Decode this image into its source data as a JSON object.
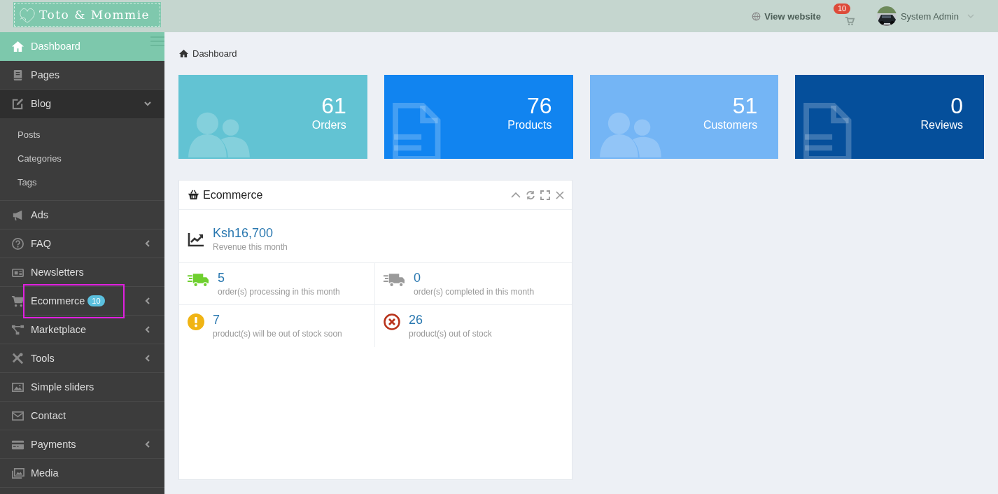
{
  "header": {
    "logo": "Toto & Mommie",
    "view_website": "View website",
    "cart_badge": "10",
    "user_name": "System Admin"
  },
  "sidebar": {
    "items": [
      {
        "label": "Dashboard",
        "kind": "link",
        "selected": true
      },
      {
        "label": "Pages",
        "kind": "link",
        "selected": false
      },
      {
        "label": "Blog",
        "kind": "group",
        "selected": false,
        "expanded": true,
        "children": [
          {
            "label": "Posts"
          },
          {
            "label": "Categories"
          },
          {
            "label": "Tags"
          }
        ]
      },
      {
        "label": "Ads",
        "kind": "link",
        "selected": false
      },
      {
        "label": "FAQ",
        "kind": "group",
        "selected": false,
        "expanded": false
      },
      {
        "label": "Newsletters",
        "kind": "link",
        "selected": false
      },
      {
        "label": "Ecommerce",
        "kind": "group",
        "selected": false,
        "expanded": false,
        "badge": "10",
        "highlighted": true
      },
      {
        "label": "Marketplace",
        "kind": "group",
        "selected": false,
        "expanded": false
      },
      {
        "label": "Tools",
        "kind": "group",
        "selected": false,
        "expanded": false
      },
      {
        "label": "Simple sliders",
        "kind": "link",
        "selected": false
      },
      {
        "label": "Contact",
        "kind": "link",
        "selected": false
      },
      {
        "label": "Payments",
        "kind": "group",
        "selected": false,
        "expanded": false
      },
      {
        "label": "Media",
        "kind": "link",
        "selected": false
      }
    ]
  },
  "breadcrumb": "Dashboard",
  "stat_cards": [
    {
      "value": "61",
      "label": "Orders",
      "color": "#62c3d3",
      "kind": "users"
    },
    {
      "value": "76",
      "label": "Products",
      "color": "#1184f0",
      "kind": "document"
    },
    {
      "value": "51",
      "label": "Customers",
      "color": "#74b5f5",
      "kind": "users"
    },
    {
      "value": "0",
      "label": "Reviews",
      "color": "#054f9b",
      "kind": "document"
    }
  ],
  "widget": {
    "title": "Ecommerce",
    "revenue": {
      "value": "Ksh16,700",
      "label": "Revenue this month"
    },
    "stats": [
      {
        "value": "5",
        "label": "order(s) processing in this month",
        "kind": "truck",
        "color": "#6fcf2f"
      },
      {
        "value": "0",
        "label": "order(s) completed in this month",
        "kind": "truck",
        "color": "#9a9a9a"
      },
      {
        "value": "7",
        "label": "product(s) will be out of stock soon",
        "kind": "warning",
        "color": "#f0b414"
      },
      {
        "value": "26",
        "label": "product(s) out of stock",
        "kind": "error",
        "color": "#b8321a"
      }
    ]
  }
}
